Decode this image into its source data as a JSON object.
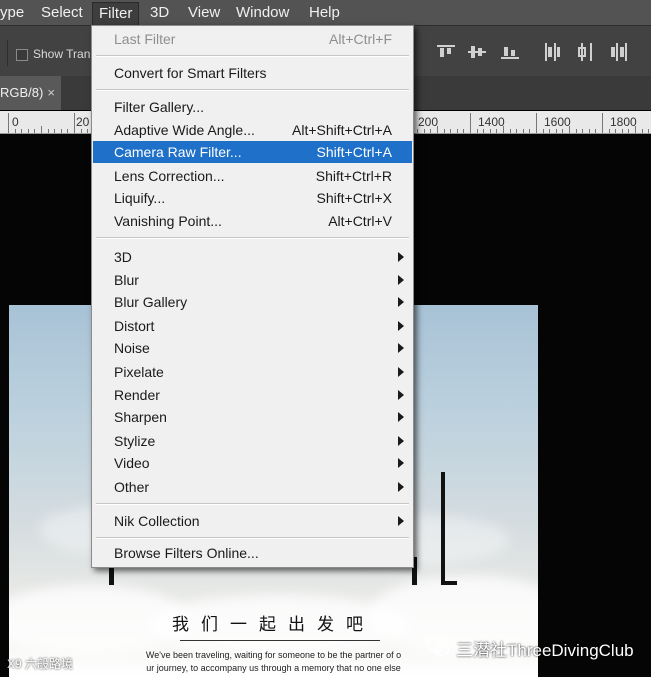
{
  "menubar": {
    "items": [
      {
        "label": "ype"
      },
      {
        "label": "Select"
      },
      {
        "label": "Filter",
        "active": true
      },
      {
        "label": "3D"
      },
      {
        "label": "View"
      },
      {
        "label": "Window"
      },
      {
        "label": "Help"
      }
    ]
  },
  "options_bar": {
    "show_transform_label": "Show Tran",
    "align_icons": [
      "align-top-edges-icon",
      "align-vertical-centers-icon",
      "align-bottom-edges-icon",
      "distribute-left-icon",
      "distribute-horizontal-centers-icon",
      "distribute-right-icon"
    ]
  },
  "doc_tab": {
    "title": "RGB/8)",
    "close": "×"
  },
  "ruler": {
    "labels": [
      "0",
      "20",
      "200",
      "1400",
      "1600",
      "1800"
    ]
  },
  "filter_menu": {
    "items": [
      {
        "label": "Last Filter",
        "shortcut": "Alt+Ctrl+F",
        "disabled": true
      },
      {
        "separator": true
      },
      {
        "label": "Convert for Smart Filters"
      },
      {
        "separator": true
      },
      {
        "label": "Filter Gallery..."
      },
      {
        "label": "Adaptive Wide Angle...",
        "shortcut": "Alt+Shift+Ctrl+A"
      },
      {
        "label": "Camera Raw Filter...",
        "shortcut": "Shift+Ctrl+A",
        "highlighted": true
      },
      {
        "label": "Lens Correction...",
        "shortcut": "Shift+Ctrl+R"
      },
      {
        "label": "Liquify...",
        "shortcut": "Shift+Ctrl+X"
      },
      {
        "label": "Vanishing Point...",
        "shortcut": "Alt+Ctrl+V"
      },
      {
        "separator": true
      },
      {
        "label": "3D",
        "submenu": true
      },
      {
        "label": "Blur",
        "submenu": true
      },
      {
        "label": "Blur Gallery",
        "submenu": true
      },
      {
        "label": "Distort",
        "submenu": true
      },
      {
        "label": "Noise",
        "submenu": true
      },
      {
        "label": "Pixelate",
        "submenu": true
      },
      {
        "label": "Render",
        "submenu": true
      },
      {
        "label": "Sharpen",
        "submenu": true
      },
      {
        "label": "Stylize",
        "submenu": true
      },
      {
        "label": "Video",
        "submenu": true
      },
      {
        "label": "Other",
        "submenu": true
      },
      {
        "separator": true
      },
      {
        "label": "Nik Collection",
        "submenu": true
      },
      {
        "separator": true
      },
      {
        "label": "Browse Filters Online..."
      }
    ]
  },
  "poster": {
    "chinese_title": "我们一起出发吧",
    "body_lines": [
      "We've been traveling, waiting for someone to be the partner of o",
      "ur journey, to accompany us through a memory that no one else"
    ]
  },
  "watermarks": {
    "right": "三潜社ThreeDivingClub",
    "left": "X9 六般路境"
  },
  "colors": {
    "menu_highlight": "#1f70c9",
    "menubar_bg": "#535353",
    "menu_bg": "#f0f0f0"
  }
}
